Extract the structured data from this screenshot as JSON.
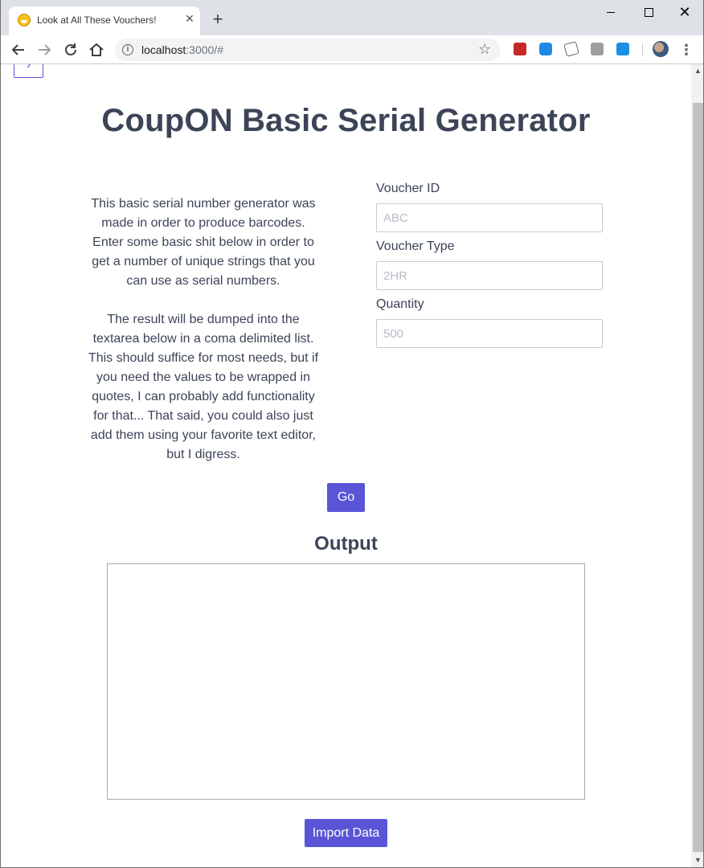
{
  "browser": {
    "tab_title": "Look at All These Vouchers!",
    "tab_close": "✕",
    "new_tab": "+",
    "window_close": "✕",
    "url_host": "localhost",
    "url_rest": ":3000/#",
    "icons": {
      "back": "arrow-left-icon",
      "forward": "arrow-right-icon",
      "reload": "reload-icon",
      "home": "home-icon",
      "info": "info-icon",
      "bookmark": "star-icon",
      "menu": "kebab-menu-icon"
    }
  },
  "page": {
    "title": "CoupON Basic Serial Generator",
    "description": [
      "This basic serial number generator was made in order to produce barcodes. Enter some basic shit below in order to get a number of unique strings that you can use as serial numbers.",
      "The result will be dumped into the textarea below in a coma delimited list. This should suffice for most needs, but if you need the values to be wrapped in quotes, I can probably add functionality for that... That said, you could also just add them using your favorite text editor, but I digress."
    ],
    "form": {
      "voucher_id": {
        "label": "Voucher ID",
        "placeholder": "ABC",
        "value": ""
      },
      "voucher_type": {
        "label": "Voucher Type",
        "placeholder": "2HR",
        "value": ""
      },
      "quantity": {
        "label": "Quantity",
        "placeholder": "500",
        "value": ""
      }
    },
    "go_label": "Go",
    "output_heading": "Output",
    "output_value": "",
    "import_label": "Import Data"
  },
  "colors": {
    "accent": "#5a55d6",
    "text": "#3c4457",
    "tabstrip": "#dee1e6"
  }
}
